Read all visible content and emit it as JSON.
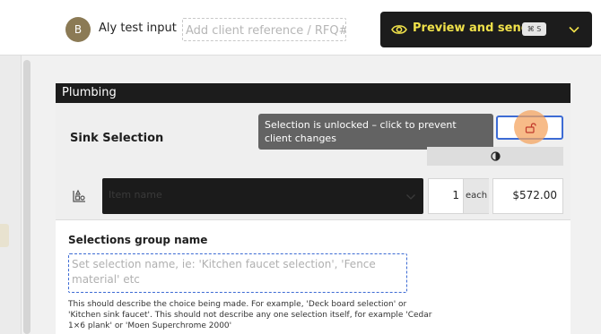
{
  "header": {
    "avatar_initial": "B",
    "client_name": "Aly test input",
    "client_reference_placeholder": "Add client reference / RFQ#",
    "preview_button": {
      "label": "Preview and send",
      "shortcut": "⌘ S",
      "icon": "eye-icon",
      "accent_color": "#f0e14a"
    }
  },
  "section": {
    "title": "Plumbing",
    "selection": {
      "name": "Sink Selection",
      "tooltip": "Selection is unlocked – click to prevent client changes",
      "lock_state": "unlocked",
      "item": {
        "placeholder": "Item name",
        "quantity": "1",
        "unit": "each",
        "price": "$572.00"
      }
    },
    "group": {
      "label": "Selections group name",
      "placeholder": "Set selection name, ie: 'Kitchen faucet selection', 'Fence material' etc",
      "help_text": "This should describe the choice being made. For example, 'Deck board selection' or 'Kitchen sink faucet'. This should not describe any one selection itself, for example 'Cedar 1×6 plank' or 'Moen Superchrome 2000'"
    }
  },
  "colors": {
    "focus_blue": "#3d6bd4",
    "header_dark": "#1c1c1c",
    "tooltip_bg": "#636363"
  }
}
